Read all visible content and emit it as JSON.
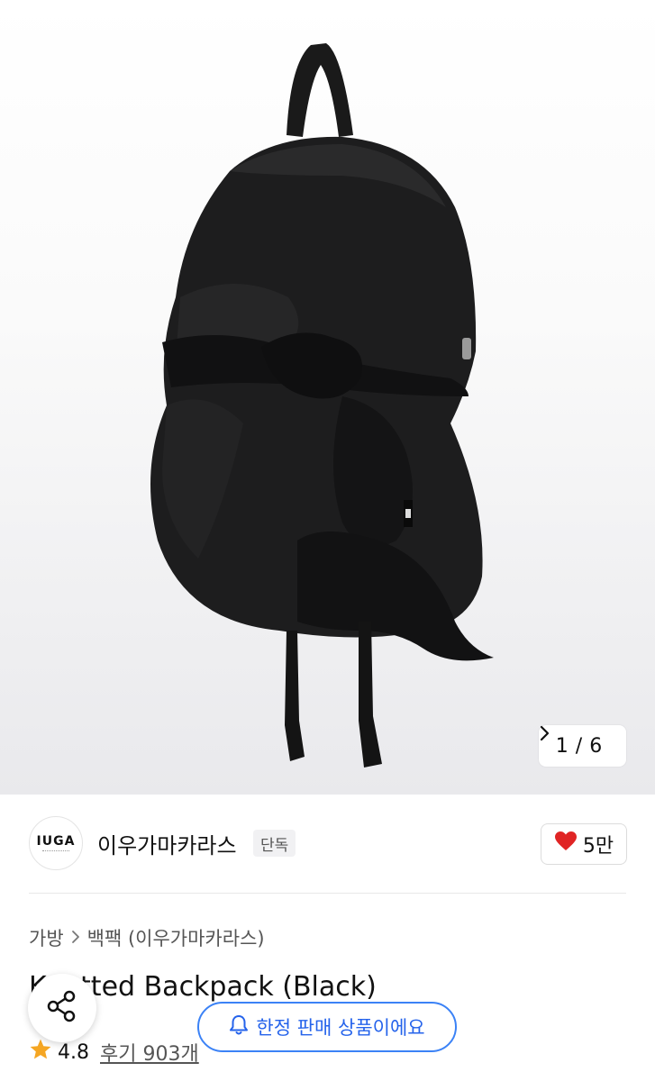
{
  "gallery": {
    "current": "1",
    "separator": "/",
    "total": "6",
    "next_icon": "chevron-right-icon",
    "image_subject": "knotted black backpack"
  },
  "brand": {
    "logo_text": "IUGA",
    "name": "이우가마카라스",
    "badge": "단독",
    "like_icon": "heart-icon",
    "like_color": "#e02424",
    "like_count": "5만"
  },
  "breadcrumb": {
    "items": [
      "가방",
      "백팩 (이우가마카라스)"
    ],
    "separator_icon": "chevron-right-icon"
  },
  "product": {
    "title": "Knotted Backpack (Black)"
  },
  "rating": {
    "star_icon": "star-icon",
    "star_color": "#f5a623",
    "score": "4.8",
    "reviews": "후기 903개"
  },
  "share": {
    "icon": "share-icon"
  },
  "notice": {
    "icon": "bell-icon",
    "text": "한정 판매 상품이에요",
    "color": "#2563eb"
  }
}
